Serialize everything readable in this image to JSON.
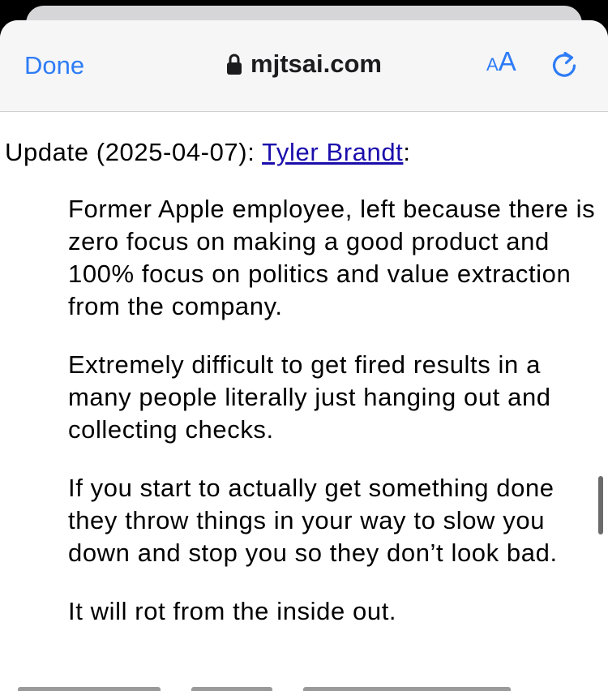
{
  "navbar": {
    "done_label": "Done",
    "url": "mjtsai.com",
    "lock_icon": "lock-icon",
    "text_size_label_small": "A",
    "text_size_label_large": "A",
    "reload_icon": "reload-icon",
    "accent_color": "#2e7cf6"
  },
  "content": {
    "update_prefix": "Update (2025-04-07): ",
    "author_link": "Tyler Brandt",
    "update_suffix": ":",
    "quote_paragraphs": [
      "Former Apple employee, left because there is zero focus on making a good product and 100% focus on politics and value extraction from the company.",
      "Extremely difficult to get fired results in a many people literally just hanging out and collecting checks.",
      "If you start to actually get something done they throw things in your way to slow you down and stop you so they don’t look bad.",
      "It will rot from the inside out."
    ],
    "link_color": "#1a0dab"
  }
}
